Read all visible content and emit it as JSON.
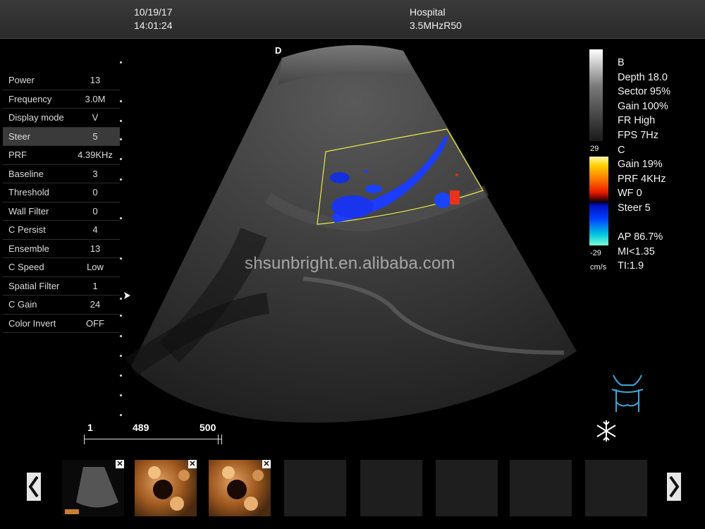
{
  "header": {
    "date": "10/19/17",
    "time": "14:01:24",
    "hospital": "Hospital",
    "probe": "3.5MHzR50"
  },
  "menu": [
    {
      "label": "Power",
      "value": "13"
    },
    {
      "label": "Frequency",
      "value": "3.0M"
    },
    {
      "label": "Display mode",
      "value": "V"
    },
    {
      "label": "Steer",
      "value": "5"
    },
    {
      "label": "PRF",
      "value": "4.39KHz"
    },
    {
      "label": "Baseline",
      "value": "3"
    },
    {
      "label": "Threshold",
      "value": "0"
    },
    {
      "label": "Wall Filter",
      "value": "0"
    },
    {
      "label": "C Persist",
      "value": "4"
    },
    {
      "label": "Ensemble",
      "value": "13"
    },
    {
      "label": "C Speed",
      "value": "Low"
    },
    {
      "label": "Spatial Filter",
      "value": "1"
    },
    {
      "label": "C Gain",
      "value": "24"
    },
    {
      "label": "Color Invert",
      "value": "OFF"
    }
  ],
  "selected_menu_item": "Steer",
  "image": {
    "orientation_marker": "D",
    "watermark": "shsunbright.en.alibaba.com"
  },
  "scale": {
    "top": "29",
    "bottom": "-29",
    "unit": "cm/s"
  },
  "readout": [
    "B",
    "Depth 18.0",
    "Sector 95%",
    "Gain 100%",
    "FR High",
    "FPS 7Hz",
    "C",
    "Gain  19%",
    "PRF 4KHz",
    "WF 0",
    "Steer 5",
    "",
    "AP 86.7%",
    "MI<1.35",
    "TI:1.9"
  ],
  "ruler": {
    "start": "1",
    "current": "489",
    "end": "500"
  },
  "icons": {
    "freeze": "snowflake-icon",
    "body_mark": "torso-body-mark-icon",
    "prev": "chevron-left-icon",
    "next": "chevron-right-icon"
  },
  "thumbnails": [
    {
      "kind": "scan",
      "closable": true
    },
    {
      "kind": "image",
      "closable": true
    },
    {
      "kind": "image",
      "closable": true
    },
    {
      "kind": "empty",
      "closable": false
    },
    {
      "kind": "empty",
      "closable": false
    },
    {
      "kind": "empty",
      "closable": false
    },
    {
      "kind": "empty",
      "closable": false
    },
    {
      "kind": "empty",
      "closable": false
    }
  ],
  "close_glyph": "✕"
}
